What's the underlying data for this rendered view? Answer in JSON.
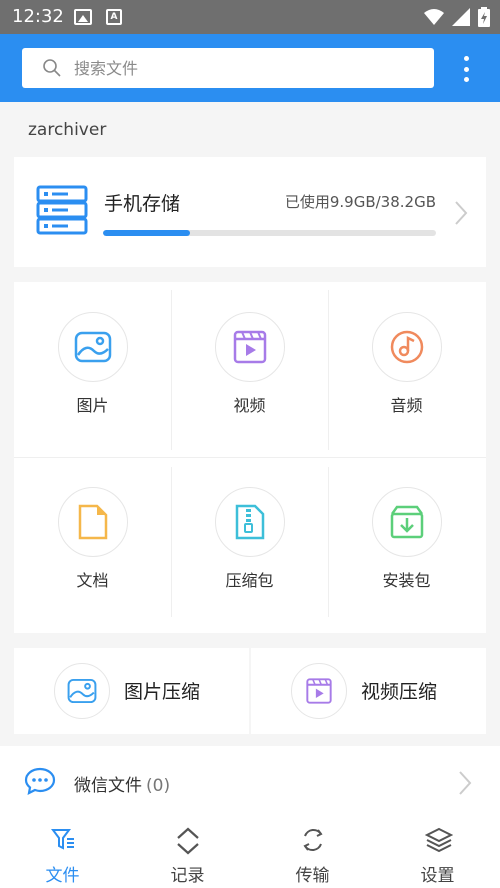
{
  "status_bar": {
    "time": "12:32"
  },
  "search": {
    "placeholder": "搜索文件"
  },
  "section_label": "zarchiver",
  "storage": {
    "title": "手机存储",
    "usage": "已使用9.9GB/38.2GB",
    "used_fraction": 0.26
  },
  "categories": [
    {
      "label": "图片",
      "icon": "image-icon",
      "color": "#3aa0ee"
    },
    {
      "label": "视频",
      "icon": "video-icon",
      "color": "#a77be8"
    },
    {
      "label": "音频",
      "icon": "audio-icon",
      "color": "#f08a5d"
    },
    {
      "label": "文档",
      "icon": "document-icon",
      "color": "#f5b74a"
    },
    {
      "label": "压缩包",
      "icon": "archive-icon",
      "color": "#3dbfd9"
    },
    {
      "label": "安装包",
      "icon": "package-icon",
      "color": "#5ccf7a"
    }
  ],
  "compress": [
    {
      "label": "图片压缩",
      "icon": "image-compress-icon"
    },
    {
      "label": "视频压缩",
      "icon": "video-compress-icon"
    }
  ],
  "wechat": {
    "label": "微信文件",
    "count": "(0)"
  },
  "nav": [
    {
      "label": "文件",
      "icon": "files-icon",
      "active": true
    },
    {
      "label": "记录",
      "icon": "history-icon",
      "active": false
    },
    {
      "label": "传输",
      "icon": "transfer-icon",
      "active": false
    },
    {
      "label": "设置",
      "icon": "settings-icon",
      "active": false
    }
  ],
  "colors": {
    "primary": "#2b8ef1",
    "background": "#f5f5f5"
  }
}
